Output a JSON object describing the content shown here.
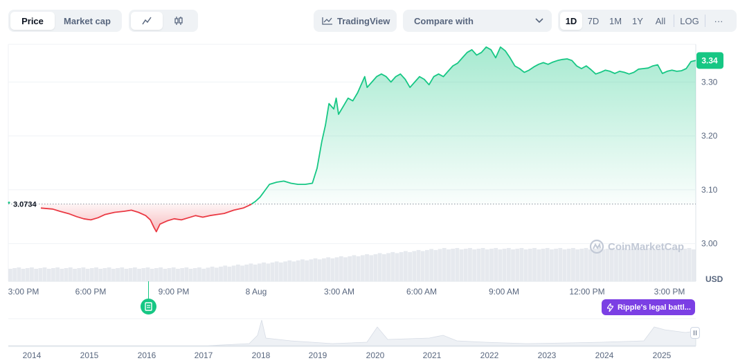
{
  "toolbar": {
    "price_tab": "Price",
    "market_cap_tab": "Market cap",
    "line_chart_icon": "line-chart-icon",
    "candlestick_icon": "candlestick-icon",
    "tradingview_label": "TradingView",
    "compare_label": "Compare with",
    "ranges": [
      "1D",
      "7D",
      "1M",
      "1Y",
      "All"
    ],
    "active_range": "1D",
    "log_label": "LOG",
    "more_label": "···"
  },
  "colors": {
    "up": "#16c784",
    "down": "#ea3943",
    "event": "#7b3fe4",
    "grid": "#eff2f5",
    "axis_text": "#58667e"
  },
  "chart_data": {
    "type": "line",
    "unit_label": "USD",
    "ylim": [
      2.93,
      3.37
    ],
    "y_ticks": [
      {
        "value": 3.3,
        "label": "3.30"
      },
      {
        "value": 3.2,
        "label": "3.20"
      },
      {
        "value": 3.1,
        "label": "3.10"
      },
      {
        "value": 3.0,
        "label": "3.00"
      }
    ],
    "x_ticks": [
      "3:00 PM",
      "6:00 PM",
      "9:00 PM",
      "8 Aug",
      "3:00 AM",
      "6:00 AM",
      "9:00 AM",
      "12:00 PM",
      "3:00 PM"
    ],
    "baseline": {
      "value": 3.0734,
      "label": "3.0734"
    },
    "current_price": {
      "value": 3.34,
      "label": "3.34"
    },
    "series": [
      {
        "values": [
          [
            0.0,
            3.0734
          ],
          [
            1.5,
            3.066
          ],
          [
            2.0,
            3.064
          ],
          [
            2.3,
            3.06
          ],
          [
            2.7,
            3.055
          ],
          [
            3.0,
            3.05
          ],
          [
            3.3,
            3.046
          ],
          [
            3.6,
            3.044
          ],
          [
            3.9,
            3.048
          ],
          [
            4.2,
            3.054
          ],
          [
            4.6,
            3.058
          ],
          [
            5.0,
            3.06
          ],
          [
            5.3,
            3.062
          ],
          [
            5.6,
            3.058
          ],
          [
            5.9,
            3.052
          ],
          [
            6.1,
            3.044
          ],
          [
            6.25,
            3.03
          ],
          [
            6.35,
            3.022
          ],
          [
            6.5,
            3.036
          ],
          [
            6.8,
            3.042
          ],
          [
            7.1,
            3.046
          ],
          [
            7.4,
            3.044
          ],
          [
            7.7,
            3.048
          ],
          [
            8.0,
            3.052
          ],
          [
            8.3,
            3.049
          ],
          [
            8.6,
            3.052
          ],
          [
            8.9,
            3.054
          ],
          [
            9.2,
            3.056
          ],
          [
            9.6,
            3.062
          ],
          [
            10.0,
            3.066
          ],
          [
            10.3,
            3.072
          ],
          [
            10.5,
            3.078
          ],
          [
            10.7,
            3.086
          ],
          [
            10.9,
            3.098
          ],
          [
            11.1,
            3.11
          ],
          [
            11.4,
            3.114
          ],
          [
            11.7,
            3.116
          ],
          [
            12.0,
            3.112
          ],
          [
            12.3,
            3.11
          ],
          [
            12.6,
            3.11
          ],
          [
            12.9,
            3.112
          ],
          [
            13.1,
            3.14
          ],
          [
            13.3,
            3.19
          ],
          [
            13.45,
            3.22
          ],
          [
            13.6,
            3.26
          ],
          [
            13.8,
            3.25
          ],
          [
            13.9,
            3.27
          ],
          [
            14.0,
            3.24
          ],
          [
            14.2,
            3.255
          ],
          [
            14.4,
            3.27
          ],
          [
            14.6,
            3.265
          ],
          [
            14.8,
            3.28
          ],
          [
            15.0,
            3.3
          ],
          [
            15.1,
            3.31
          ],
          [
            15.2,
            3.29
          ],
          [
            15.4,
            3.3
          ],
          [
            15.6,
            3.31
          ],
          [
            15.8,
            3.315
          ],
          [
            16.0,
            3.31
          ],
          [
            16.2,
            3.3
          ],
          [
            16.4,
            3.31
          ],
          [
            16.6,
            3.315
          ],
          [
            16.8,
            3.305
          ],
          [
            17.0,
            3.29
          ],
          [
            17.2,
            3.3
          ],
          [
            17.4,
            3.31
          ],
          [
            17.6,
            3.305
          ],
          [
            17.8,
            3.295
          ],
          [
            18.0,
            3.31
          ],
          [
            18.2,
            3.315
          ],
          [
            18.4,
            3.31
          ],
          [
            18.6,
            3.32
          ],
          [
            18.8,
            3.33
          ],
          [
            19.0,
            3.335
          ],
          [
            19.2,
            3.345
          ],
          [
            19.4,
            3.355
          ],
          [
            19.6,
            3.36
          ],
          [
            19.8,
            3.35
          ],
          [
            20.0,
            3.355
          ],
          [
            20.2,
            3.365
          ],
          [
            20.4,
            3.36
          ],
          [
            20.6,
            3.345
          ],
          [
            20.8,
            3.365
          ],
          [
            21.0,
            3.358
          ],
          [
            21.2,
            3.345
          ],
          [
            21.4,
            3.33
          ],
          [
            21.6,
            3.325
          ],
          [
            21.8,
            3.318
          ],
          [
            22.0,
            3.322
          ],
          [
            22.2,
            3.328
          ],
          [
            22.4,
            3.333
          ],
          [
            22.6,
            3.336
          ],
          [
            22.8,
            3.333
          ],
          [
            23.0,
            3.337
          ],
          [
            23.2,
            3.34
          ],
          [
            23.4,
            3.342
          ],
          [
            23.6,
            3.343
          ],
          [
            23.8,
            3.34
          ],
          [
            24.0,
            3.33
          ],
          [
            24.2,
            3.325
          ],
          [
            24.4,
            3.33
          ],
          [
            24.6,
            3.323
          ],
          [
            24.8,
            3.315
          ],
          [
            25.0,
            3.318
          ],
          [
            25.2,
            3.322
          ],
          [
            25.4,
            3.32
          ],
          [
            25.6,
            3.316
          ],
          [
            25.8,
            3.32
          ],
          [
            26.0,
            3.318
          ],
          [
            26.2,
            3.315
          ],
          [
            26.4,
            3.318
          ],
          [
            26.6,
            3.324
          ],
          [
            26.8,
            3.325
          ],
          [
            27.0,
            3.326
          ],
          [
            27.2,
            3.33
          ],
          [
            27.4,
            3.332
          ],
          [
            27.6,
            3.316
          ],
          [
            27.8,
            3.32
          ],
          [
            28.0,
            3.322
          ],
          [
            28.2,
            3.32
          ],
          [
            28.4,
            3.321
          ],
          [
            28.6,
            3.325
          ],
          [
            28.8,
            3.338
          ],
          [
            29.0,
            3.34
          ]
        ]
      }
    ],
    "volume_bars": 160
  },
  "events": {
    "news_icon": "document-icon",
    "news_label": "Ripple's legal battl..."
  },
  "navigator": {
    "years": [
      "2014",
      "2015",
      "2016",
      "2017",
      "2018",
      "2019",
      "2020",
      "2021",
      "2022",
      "2023",
      "2024",
      "2025"
    ],
    "handle_icon": "drag-handle-icon"
  },
  "watermark": "CoinMarketCap"
}
